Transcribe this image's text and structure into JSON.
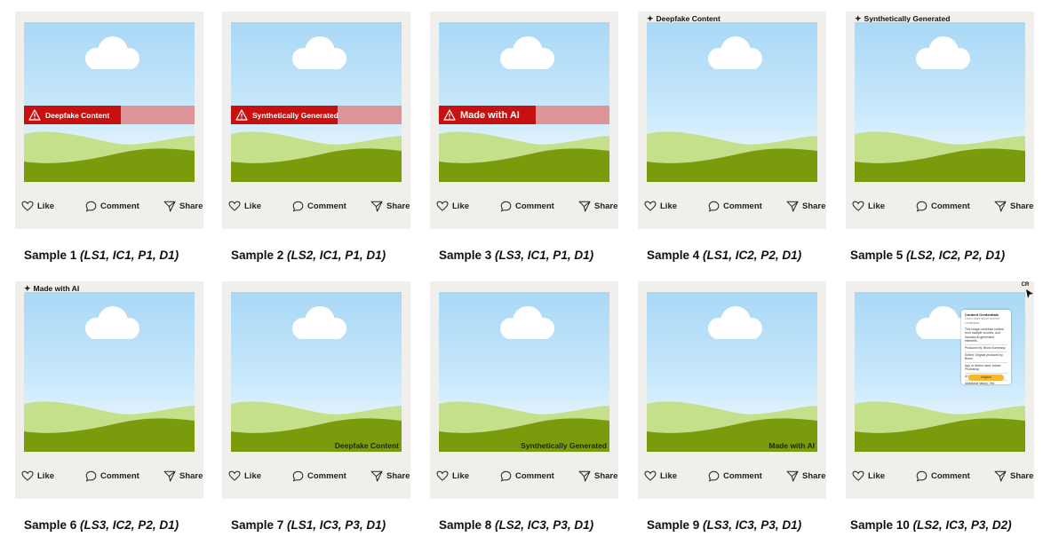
{
  "actions": {
    "like": "Like",
    "comment": "Comment",
    "share": "Share"
  },
  "colors": {
    "sky": "#a9d8f6",
    "hill_light": "#c5e08a",
    "hill_dark": "#7a9b0c",
    "banner_red": "#c81010",
    "banner_pink": "#de959a",
    "card": "#f0efec",
    "panel_button": "#f5b731"
  },
  "samples": [
    {
      "caption": "Sample 1",
      "params": "(LS1, IC1, P1, D1)",
      "variant": "banner",
      "label": "Deepfake Content"
    },
    {
      "caption": "Sample 2",
      "params": "(LS2, IC1, P1, D1)",
      "variant": "banner",
      "label": "Synthetically Generated"
    },
    {
      "caption": "Sample 3",
      "params": "(LS3, IC1, P1, D1)",
      "variant": "banner",
      "label": "Made with AI"
    },
    {
      "caption": "Sample 4",
      "params": "(LS1, IC2, P2, D1)",
      "variant": "top",
      "label": "Deepfake Content"
    },
    {
      "caption": "Sample 5",
      "params": "(LS2, IC2, P2, D1)",
      "variant": "top",
      "label": "Synthetically Generated"
    },
    {
      "caption": "Sample 6",
      "params": "(LS3, IC2, P2, D1)",
      "variant": "top",
      "label": "Made with AI"
    },
    {
      "caption": "Sample 7",
      "params": "(LS1, IC3, P3, D1)",
      "variant": "corner",
      "label": "Deepfake Content"
    },
    {
      "caption": "Sample 8",
      "params": "(LS2, IC3, P3, D1)",
      "variant": "corner",
      "label": "Synthetically Generated"
    },
    {
      "caption": "Sample 9",
      "params": "(LS3, IC3, P3, D1)",
      "variant": "corner",
      "label": "Made with AI"
    },
    {
      "caption": "Sample 10",
      "params": "(LS2, IC3, P3, D2)",
      "variant": "credentials",
      "label": "CR"
    }
  ],
  "credentials_panel": {
    "title": "Content Credentials",
    "subtitle": "Learn more about content credentials",
    "intro": "This image combines content from multiple sources, and includes AI-generated elements.",
    "lines": [
      "Produced by: Bruno Kaminsky",
      "Edited: Original produced by Bruno",
      "App or device used: Adobe Photoshop",
      "AI tool used: Adobe Firefly",
      "Additional history: Yes"
    ],
    "button": "Inspect"
  }
}
